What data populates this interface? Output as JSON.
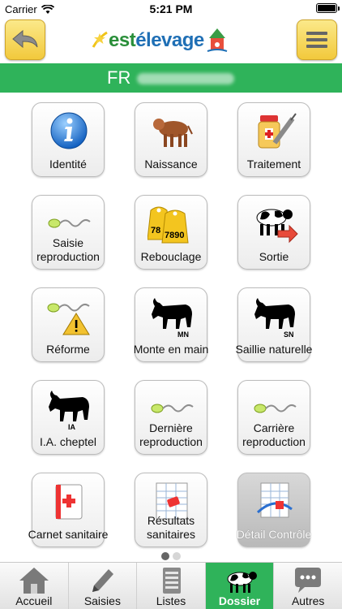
{
  "status_bar": {
    "carrier": "Carrier",
    "time": "5:21 PM"
  },
  "header": {
    "logo_part1": "est",
    "logo_part2": "élevage"
  },
  "id_bar": {
    "prefix": "FR"
  },
  "tiles": [
    {
      "label": "Identité",
      "icon": "info-icon"
    },
    {
      "label": "Naissance",
      "icon": "calf-icon"
    },
    {
      "label": "Traitement",
      "icon": "medicine-syringe-icon"
    },
    {
      "label": "Saisie reproduction",
      "icon": "sperm-icon"
    },
    {
      "label": "Rebouclage",
      "icon": "ear-tags-icon",
      "tag_numbers": [
        "78",
        "7890"
      ]
    },
    {
      "label": "Sortie",
      "icon": "cow-exit-icon"
    },
    {
      "label": "Réforme",
      "icon": "sperm-warning-icon"
    },
    {
      "label": "Monte en main",
      "icon": "bull-mn-icon",
      "badge": "MN"
    },
    {
      "label": "Saillie naturelle",
      "icon": "bull-sn-icon",
      "badge": "SN"
    },
    {
      "label": "I.A. cheptel",
      "icon": "bull-ia-icon",
      "badge": "IA"
    },
    {
      "label": "Dernière reproduction",
      "icon": "sperm-icon"
    },
    {
      "label": "Carrière reproduction",
      "icon": "sperm-icon"
    },
    {
      "label": "Carnet sanitaire",
      "icon": "health-book-icon"
    },
    {
      "label": "Résultats sanitaires",
      "icon": "spreadsheet-report-icon"
    },
    {
      "label": "Détail Contrôle",
      "icon": "spreadsheet-control-icon",
      "disabled": true
    }
  ],
  "pager": {
    "pages": 2,
    "current": 0
  },
  "tabs": [
    {
      "label": "Accueil",
      "icon": "house-icon"
    },
    {
      "label": "Saisies",
      "icon": "pencil-icon"
    },
    {
      "label": "Listes",
      "icon": "list-icon"
    },
    {
      "label": "Dossier",
      "icon": "cow-icon",
      "active": true
    },
    {
      "label": "Autres",
      "icon": "chat-bubble-icon"
    }
  ],
  "colors": {
    "green": "#2fb35a",
    "yellow_button": "#f2c93c"
  }
}
